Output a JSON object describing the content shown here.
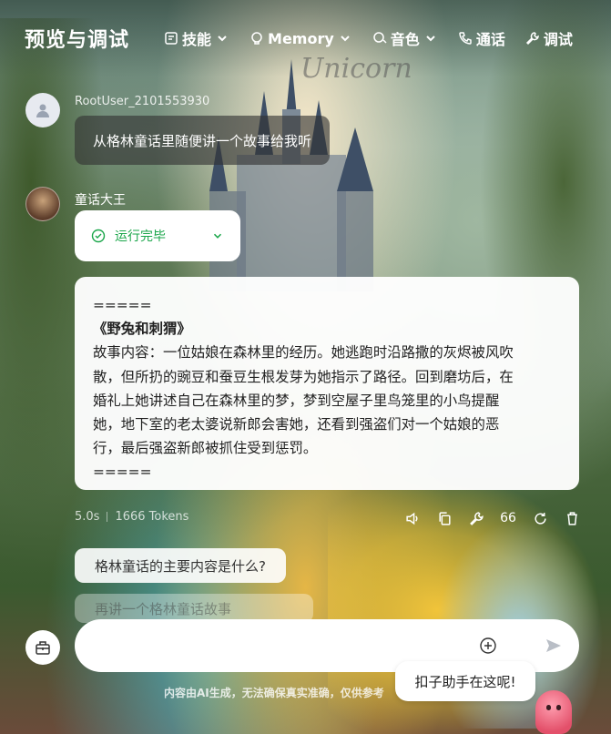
{
  "header": {
    "title": "预览与调试",
    "nav": [
      {
        "label": "技能",
        "icon": "skills-icon",
        "dropdown": true
      },
      {
        "label": "Memory",
        "icon": "memory-icon",
        "dropdown": true
      },
      {
        "label": "音色",
        "icon": "voice-icon",
        "dropdown": true
      },
      {
        "label": "通话",
        "icon": "phone-icon",
        "dropdown": false
      },
      {
        "label": "调试",
        "icon": "wrench-icon",
        "dropdown": false
      }
    ]
  },
  "conversation": {
    "user": {
      "name": "RootUser_2101553930",
      "message": "从格林童话里随便讲一个故事给我听"
    },
    "bot": {
      "name": "童话大王",
      "status": "运行完毕",
      "answer_lines": [
        "=====",
        "《野兔和刺猬》",
        "故事内容：一位姑娘在森林里的经历。她逃跑时沿路撒的灰烬被风吹",
        "散，但所扔的豌豆和蚕豆生根发芽为她指示了路径。回到磨坊后，在",
        "婚礼上她讲述自己在森林里的梦，梦到空屋子里鸟笼里的小鸟提醒",
        "她，地下室的老太婆说新郎会害她，还看到强盗们对一个姑娘的恶",
        "行，最后强盗新郎被抓住受到惩罚。",
        "====="
      ],
      "meta": {
        "time": "5.0s",
        "tokens": "1666 Tokens"
      },
      "actions": [
        {
          "name": "speaker-icon"
        },
        {
          "name": "copy-icon"
        },
        {
          "name": "debug-icon"
        },
        {
          "name": "quote-icon",
          "glyph": "66"
        },
        {
          "name": "regenerate-icon"
        },
        {
          "name": "delete-icon"
        }
      ]
    },
    "suggestions": [
      "格林童话的主要内容是什么?",
      "再讲一个格林童话故事"
    ]
  },
  "input": {
    "placeholder": ""
  },
  "disclaimer": "内容由AI生成，无法确保真实准确，仅供参考",
  "helper": {
    "text": "扣子助手在这呢!"
  }
}
